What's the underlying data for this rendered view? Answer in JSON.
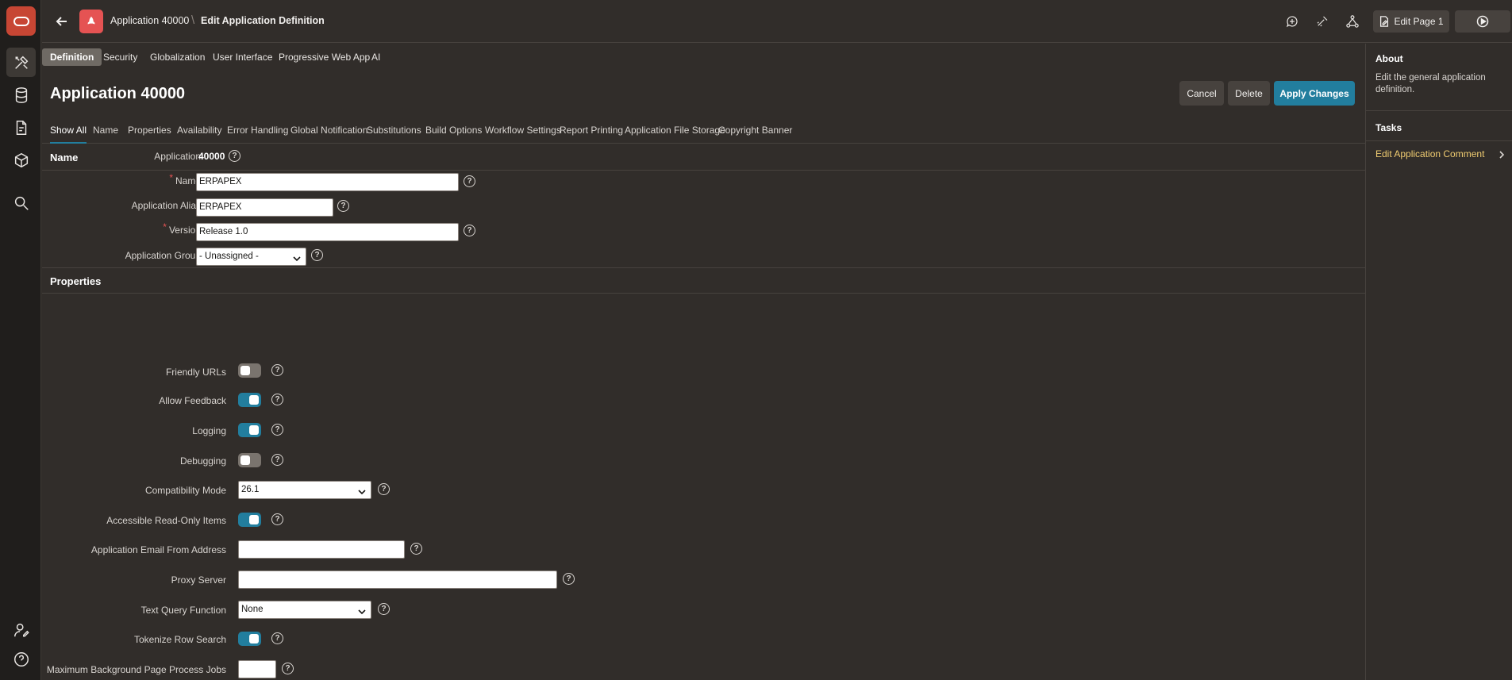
{
  "breadcrumb": {
    "app": "Application 40000",
    "page": "Edit Application Definition"
  },
  "toolbar": {
    "edit_page_label": "Edit Page 1"
  },
  "tabs": [
    "Definition",
    "Security",
    "Globalization",
    "User Interface",
    "Progressive Web App",
    "AI"
  ],
  "main": {
    "title": "Application 40000",
    "buttons": {
      "cancel": "Cancel",
      "delete": "Delete",
      "apply": "Apply Changes"
    },
    "subtabs": [
      "Show All",
      "Name",
      "Properties",
      "Availability",
      "Error Handling",
      "Global Notification",
      "Substitutions",
      "Build Options",
      "Workflow Settings",
      "Report Printing",
      "Application File Storage",
      "Copyright Banner"
    ]
  },
  "name_region": {
    "title": "Name",
    "application_label": "Application",
    "application_value": "40000",
    "name_label": "Name",
    "name_value": "ERPAPEX",
    "alias_label": "Application Alias",
    "alias_value": "ERPAPEX",
    "version_label": "Version",
    "version_value": "Release 1.0",
    "group_label": "Application Group",
    "group_value": "- Unassigned -",
    "required_mark": "*"
  },
  "properties_region": {
    "title": "Properties",
    "friendly_urls_label": "Friendly URLs",
    "friendly_urls_on": false,
    "allow_feedback_label": "Allow Feedback",
    "allow_feedback_on": true,
    "logging_label": "Logging",
    "logging_on": true,
    "debugging_label": "Debugging",
    "debugging_on": false,
    "compat_label": "Compatibility Mode",
    "compat_value": "26.1",
    "accessible_label": "Accessible Read-Only Items",
    "accessible_on": true,
    "email_label": "Application Email From Address",
    "email_value": "",
    "proxy_label": "Proxy Server",
    "proxy_value": "",
    "tqf_label": "Text Query Function",
    "tqf_value": "None",
    "tokenize_label": "Tokenize Row Search",
    "tokenize_on": true,
    "maxjobs_label": "Maximum Background Page Process Jobs",
    "maxjobs_value": ""
  },
  "help_glyph": "?",
  "right_panel": {
    "about_title": "About",
    "about_text": "Edit the general application definition.",
    "tasks_title": "Tasks",
    "task_link": "Edit Application Comment"
  },
  "colors": {
    "accent": "#227e9e",
    "brand": "#c74634",
    "app_icon": "#e55353",
    "link": "#f0cc71"
  }
}
